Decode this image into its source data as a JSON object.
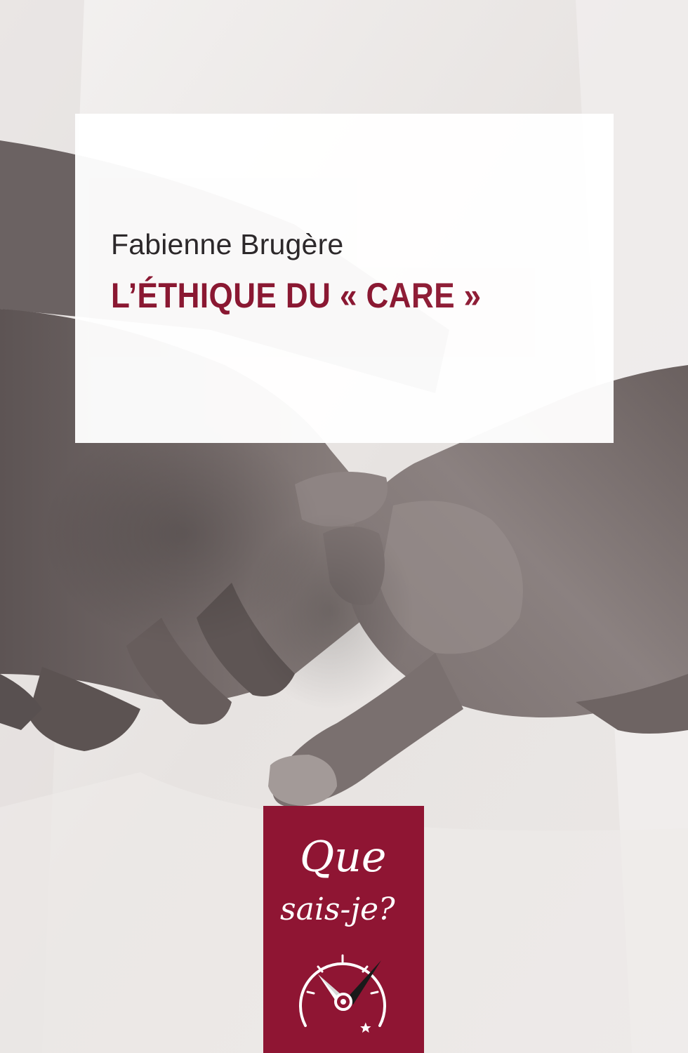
{
  "book": {
    "author": "Fabienne Brugère",
    "title": "L’ÉTHIQUE DU « CARE »"
  },
  "series": {
    "line1": "Que",
    "line2": "sais-je?",
    "logo_icon": "compass-icon"
  },
  "colors": {
    "title_red": "#8c1631",
    "badge_red": "#8f1533",
    "panel_white": "#ffffff",
    "photo_tone": "sepia-grey"
  }
}
